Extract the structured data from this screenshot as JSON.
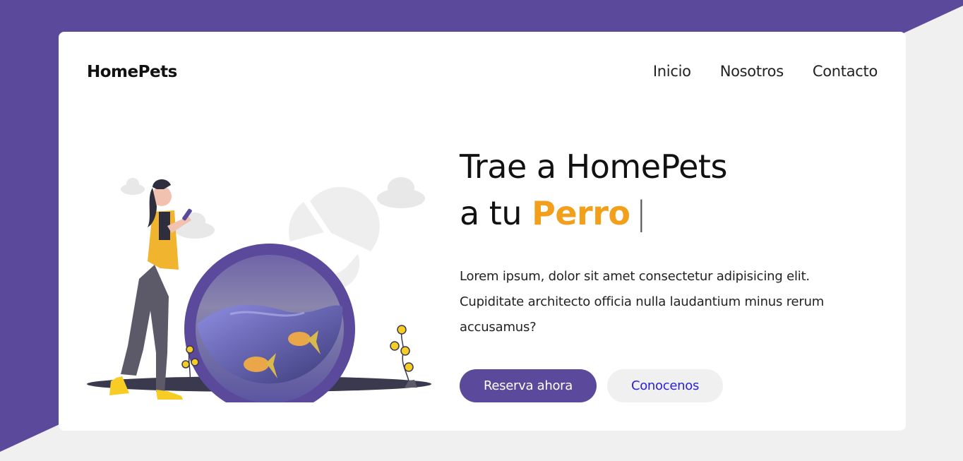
{
  "brand": {
    "name": "HomePets"
  },
  "nav": {
    "items": [
      "Inicio",
      "Nosotros",
      "Contacto"
    ]
  },
  "hero": {
    "title_line1": "Trae a HomePets",
    "title_line2_prefix": "a tu",
    "title_highlight": "Perro",
    "caret": "|",
    "description": "Lorem ipsum, dolor sit amet consectetur adipisicing elit. Cupiditate architecto officia nulla laudantium minus rerum accusamus?",
    "primary_button": "Reserva ahora",
    "secondary_button": "Conocenos"
  },
  "colors": {
    "brand_purple": "#5b4a9c",
    "accent_orange": "#f29f1c",
    "link_blue": "#2a1fd6",
    "background_gray": "#f0f0f0"
  }
}
